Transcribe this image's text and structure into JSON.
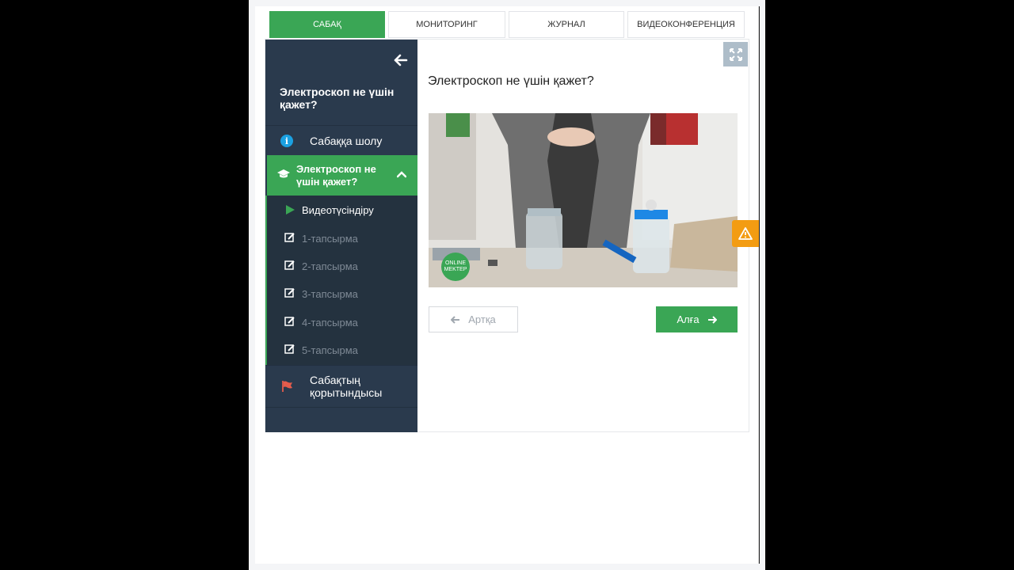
{
  "tabs": [
    {
      "label": "САБАҚ",
      "active": true
    },
    {
      "label": "МОНИТОРИНГ",
      "active": false
    },
    {
      "label": "ЖУРНАЛ",
      "active": false
    },
    {
      "label": "ВИДЕОКОНФЕРЕНЦИЯ",
      "active": false
    }
  ],
  "sidebar": {
    "title": "Электроскоп не үшін қажет?",
    "overview": "Сабаққа шолу",
    "active_section": "Электроскоп не үшін қажет?",
    "sub_items": [
      {
        "label": "Видеотүсіндіру",
        "current": true
      },
      {
        "label": "1-тапсырма",
        "current": false
      },
      {
        "label": "2-тапсырма",
        "current": false
      },
      {
        "label": "3-тапсырма",
        "current": false
      },
      {
        "label": "4-тапсырма",
        "current": false
      },
      {
        "label": "5-тапсырма",
        "current": false
      }
    ],
    "conclusion": "Сабақтың қорытындысы"
  },
  "content": {
    "title": "Электроскоп не үшін қажет?",
    "video_logo": "ONLINE MEKTEP"
  },
  "buttons": {
    "back": "Артқа",
    "next": "Алға"
  },
  "colors": {
    "accent": "#3aa655",
    "sidebar": "#2a3a4d",
    "warning": "#f39c12",
    "info": "#1ba1e2"
  }
}
